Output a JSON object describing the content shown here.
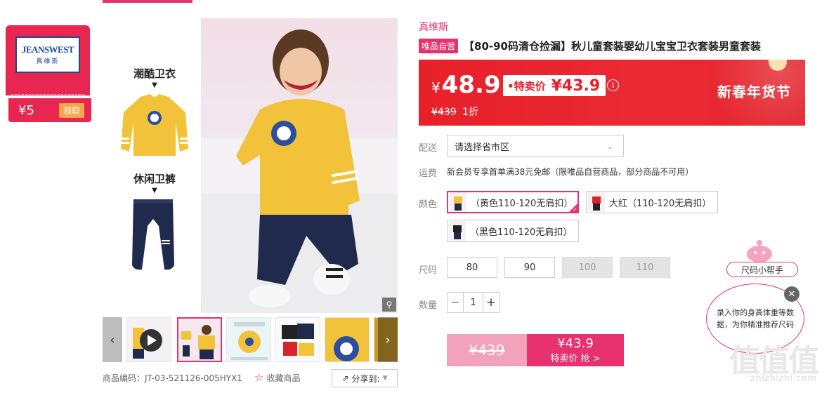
{
  "coupon": {
    "brand_line1": "JEANSWEST",
    "brand_line2": "真维斯",
    "value": "¥5",
    "button": "领取"
  },
  "gallery": {
    "outfit_top": "潮酷卫衣",
    "outfit_bottom": "休闲卫裤",
    "arrow": "▼",
    "zoom_icon": "magnifier-icon",
    "prev": "‹",
    "next": "›"
  },
  "product": {
    "brand": "真维斯",
    "tag": "唯品自营",
    "title": "【80-90码清仓捡漏】秋儿童套装婴幼儿宝宝卫衣套装男童套装",
    "code": "商品编码：JT-03-521126-005HYX1",
    "favorite": "收藏商品",
    "share": "分享到:"
  },
  "price": {
    "currency": "¥",
    "price": "48.9",
    "special_label": "•特卖价",
    "special_value": "¥43.9",
    "original": "¥439",
    "discount": "1折",
    "festival": "新春年货节"
  },
  "delivery": {
    "label": "配送",
    "placeholder": "请选择省市区"
  },
  "shipping": {
    "label": "运费",
    "text": "新会员专享首单满38元免邮（限唯品自营商品，部分商品不可用）"
  },
  "color": {
    "label": "颜色",
    "options": [
      "（黄色110-120无肩扣）",
      "大红（110-120无肩扣）",
      "（黑色110-120无肩扣）"
    ],
    "selected": 0
  },
  "size": {
    "label": "尺码",
    "options": [
      "80",
      "90",
      "100",
      "110"
    ],
    "disabled": [
      "100",
      "110"
    ]
  },
  "quantity": {
    "label": "数量",
    "value": "1",
    "minus": "−",
    "plus": "+"
  },
  "buy": {
    "original": "¥439",
    "price": "¥43.9",
    "cta": "特卖价 抢 >"
  },
  "helper": {
    "tag": "尺码小帮手",
    "bubble": "录入你的身高体重等数据，为你精准推荐尺码",
    "close": "✕"
  },
  "watermark": {
    "logo": "值值值",
    "url": "zhizhizhi.com"
  },
  "colors": {
    "accent": "#e7326f",
    "banner_red": "#e8202a",
    "coupon_red": "#e8264f",
    "coupon_btn": "#f7a64c"
  }
}
